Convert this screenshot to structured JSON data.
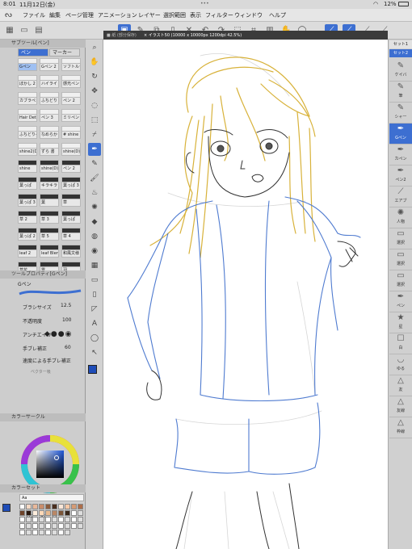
{
  "status": {
    "time": "8:01",
    "date": "11月12日(金)",
    "battery": "12%",
    "dots": "•••"
  },
  "menu": [
    "ファイル",
    "編集",
    "ページ管理",
    "アニメーション",
    "レイヤー",
    "選択範囲",
    "表示",
    "フィルター",
    "ウィンドウ",
    "ヘルプ"
  ],
  "document_tab": {
    "inactive": "■ 紙 (部分保存)",
    "active": "× イラスト50 (10000 x 10000px 1200dpi 42.5%)"
  },
  "sub_tool": {
    "header": "サブツール[ペン]",
    "tabs": [
      "ペン",
      "マーカー"
    ],
    "rows": [
      [
        "Gペン",
        "Gペン 2",
        "ソフトルール"
      ],
      [
        "ぼかし 2 ",
        "ハイライ ",
        "感光ペン"
      ],
      [
        "カブラペン",
        "ふちどり",
        "ペン 2"
      ],
      [
        "Hair Detail",
        "ペン 3",
        "ミリペン"
      ],
      [
        "ふちどりペン",
        "なめらか",
        "# shine"
      ],
      [
        "shine2(D)",
        "ずら 書",
        "shine(D)"
      ],
      [
        "shine",
        "shine(D)",
        "ペン 2"
      ],
      [
        "葉っぱ",
        "キラキラ",
        "葉っぱ 3"
      ],
      [
        "葉っぱ 3",
        "葉 ",
        "草"
      ],
      [
        "草 2",
        "草 3",
        "葉っぱ"
      ],
      [
        "葉っぱ 2",
        "草 5",
        "草 4"
      ],
      [
        "leaf 2",
        "leaf Blend",
        "和風文様"
      ],
      [
        "草花 ",
        "雪 ",
        "羽 "
      ]
    ]
  },
  "tool_property": {
    "header": "ツールプロパティ[Gペン]",
    "brush_name": "Gペン",
    "brush_size_label": "ブラシサイズ",
    "brush_size_value": "12.5",
    "opacity_label": "不透明度",
    "opacity_value": "100",
    "aa_label": "アンチエイリ",
    "stabilizer_label": "手ブレ補正",
    "stabilizer_value": "60",
    "speed_stabilizer_label": "速度による手ブレ補正",
    "vector_label": "ベクター吸"
  },
  "color_wheel": {
    "header": "カラーサークル",
    "h": "212",
    "s": "95",
    "v": "73"
  },
  "color_set": {
    "header": "カラーセット",
    "name": "Aa"
  },
  "right_panel": {
    "top_tabs": [
      "セット1",
      "セット2"
    ],
    "items": [
      "ケイバ",
      "筆",
      "シャー",
      "Gペン",
      "カペン",
      "ペン2",
      "エアブ",
      "人物",
      "選択",
      "選択",
      "選択",
      "ペン",
      "星",
      "白",
      "ゆる",
      "友",
      "友線",
      "枠線"
    ]
  },
  "colors": {
    "accent": "#3d6fd1",
    "hair": "#d8b23a",
    "jacket": "#4f7bd0",
    "fg_color": "#1f4db8"
  }
}
